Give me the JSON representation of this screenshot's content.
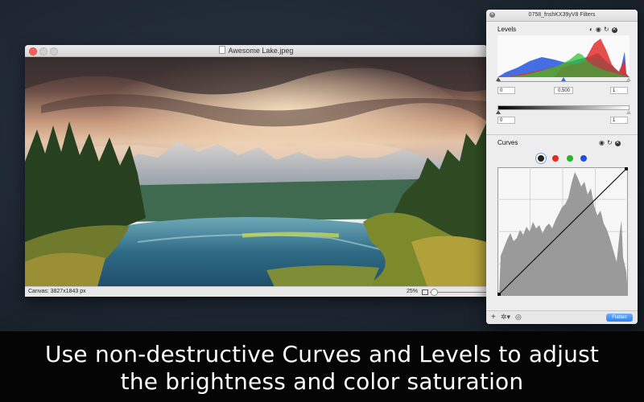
{
  "image_window": {
    "title": "Awesome Lake.jpeg",
    "canvas_info": "Canvas: 3827x1843 px",
    "zoom": "25%",
    "zoom_fraction": 0.05
  },
  "filters_panel": {
    "title": "0758_fnshKX39yV8 Filters",
    "levels": {
      "label": "Levels",
      "input_black": "0",
      "input_gamma": "0.500",
      "input_white": "1",
      "output_black": "0",
      "output_white": "1"
    },
    "curves": {
      "label": "Curves",
      "channels": [
        {
          "name": "rgb",
          "color": "#222222",
          "selected": true
        },
        {
          "name": "red",
          "color": "#e02c22",
          "selected": false
        },
        {
          "name": "green",
          "color": "#27b52b",
          "selected": false
        },
        {
          "name": "blue",
          "color": "#2150d8",
          "selected": false
        }
      ]
    },
    "flatten_label": "Flatten"
  },
  "caption": {
    "line1": "Use non-destructive Curves and Levels to adjust",
    "line2": "the brightness and color saturation"
  }
}
